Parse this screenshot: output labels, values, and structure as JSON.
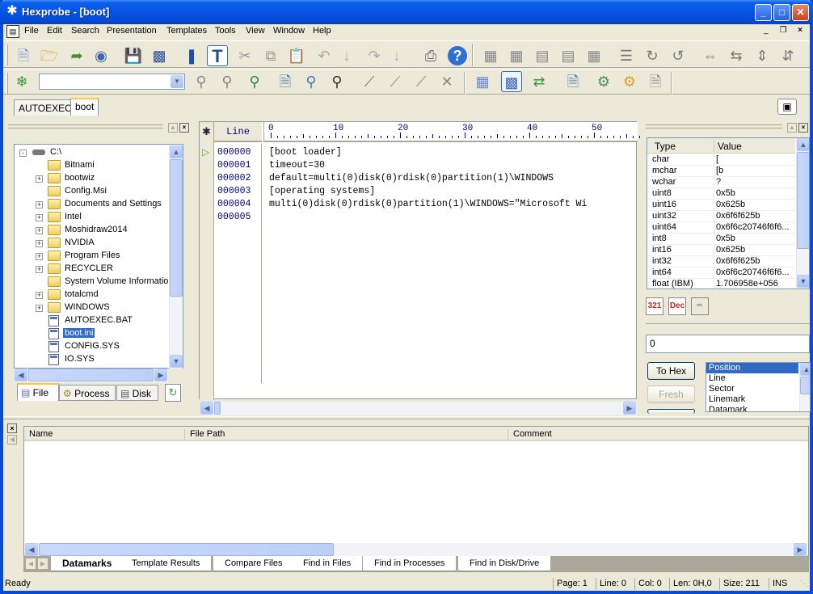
{
  "window": {
    "title": "Hexprobe - [boot]",
    "icon": "hexprobe-app-icon",
    "controls": [
      "minimize",
      "maximize",
      "close"
    ]
  },
  "menu": {
    "items": [
      "File",
      "Edit",
      "Search",
      "Presentation",
      "Templates",
      "Tools",
      "View",
      "Window",
      "Help"
    ],
    "mdi_controls": [
      "_",
      "❐",
      "×"
    ]
  },
  "toolbar1": {
    "icons": [
      "new-file-icon",
      "open-file-icon",
      "open-drive-icon",
      "open-disk-icon",
      "save-icon",
      "save-all-icon",
      "bookmark-icon",
      "text-mode-icon",
      "cut-icon",
      "copy-icon",
      "paste-icon",
      "undo-icon",
      "undo-down-icon",
      "redo-icon",
      "redo-down-icon",
      "print-icon",
      "help-icon",
      "grid-view-1-icon",
      "grid-view-2-icon",
      "grid-view-3-icon",
      "grid-view-4-icon",
      "grid-view-5-icon",
      "record-list-icon",
      "rotate-right-icon",
      "rotate-left-icon",
      "expand-horizontal-icon",
      "collapse-horizontal-icon",
      "expand-vertical-icon",
      "collapse-vertical-icon"
    ]
  },
  "toolbar2": {
    "search_combo_value": "",
    "icons": [
      "find-icon",
      "find-next-icon",
      "find-previous-icon",
      "find-in-files-icon",
      "find-in-processes-icon",
      "find-in-disk-icon",
      "mark-icon",
      "mark-next-icon",
      "mark-previous-icon",
      "clear-marks-icon",
      "calculator-icon",
      "data-inspector-icon",
      "base-converter-icon",
      "compare-files-icon",
      "template-settings-icon",
      "template-options-icon",
      "template-results-icon"
    ]
  },
  "doc_tabs": [
    {
      "label": "AUTOEXEC",
      "active": false
    },
    {
      "label": "boot",
      "active": true
    }
  ],
  "file_panel": {
    "tree": [
      {
        "label": "C:\\",
        "type": "drive",
        "level": 0,
        "expander": "-"
      },
      {
        "label": "Bitnami",
        "type": "folder",
        "level": 1,
        "expander": ""
      },
      {
        "label": "bootwiz",
        "type": "folder",
        "level": 1,
        "expander": "+"
      },
      {
        "label": "Config.Msi",
        "type": "folder",
        "level": 1,
        "expander": ""
      },
      {
        "label": "Documents and Settings",
        "type": "folder",
        "level": 1,
        "expander": "+"
      },
      {
        "label": "Intel",
        "type": "folder",
        "level": 1,
        "expander": "+"
      },
      {
        "label": "Moshidraw2014",
        "type": "folder",
        "level": 1,
        "expander": "+"
      },
      {
        "label": "NVIDIA",
        "type": "folder",
        "level": 1,
        "expander": "+"
      },
      {
        "label": "Program Files",
        "type": "folder",
        "level": 1,
        "expander": "+"
      },
      {
        "label": "RECYCLER",
        "type": "folder",
        "level": 1,
        "expander": "+"
      },
      {
        "label": "System Volume Information",
        "type": "folder",
        "level": 1,
        "expander": ""
      },
      {
        "label": "totalcmd",
        "type": "folder",
        "level": 1,
        "expander": "+"
      },
      {
        "label": "WINDOWS",
        "type": "folder",
        "level": 1,
        "expander": "+"
      },
      {
        "label": "AUTOEXEC.BAT",
        "type": "file",
        "level": 1,
        "expander": ""
      },
      {
        "label": "boot.ini",
        "type": "file",
        "level": 1,
        "expander": "",
        "selected": true
      },
      {
        "label": "CONFIG.SYS",
        "type": "file",
        "level": 1,
        "expander": ""
      },
      {
        "label": "IO.SYS",
        "type": "file",
        "level": 1,
        "expander": ""
      }
    ],
    "tabs": [
      {
        "label": "File",
        "active": true
      },
      {
        "label": "Process",
        "active": false
      },
      {
        "label": "Disk",
        "active": false
      }
    ]
  },
  "editor": {
    "line_header": "Line",
    "ruler_labels": [
      "0",
      "10",
      "20",
      "30",
      "40",
      "50"
    ],
    "lines": [
      {
        "num": "000000",
        "text": "[boot loader]"
      },
      {
        "num": "000001",
        "text": "timeout=30"
      },
      {
        "num": "000002",
        "text": "default=multi(0)disk(0)rdisk(0)partition(1)\\WINDOWS"
      },
      {
        "num": "000003",
        "text": "[operating systems]"
      },
      {
        "num": "000004",
        "text": "multi(0)disk(0)rdisk(0)partition(1)\\WINDOWS=\"Microsoft Wi"
      },
      {
        "num": "000005",
        "text": ""
      }
    ],
    "current_line_marker": "play-arrow"
  },
  "inspector": {
    "headers": [
      "Type",
      "Value"
    ],
    "rows": [
      {
        "type": "char",
        "value": "["
      },
      {
        "type": "mchar",
        "value": "[b"
      },
      {
        "type": "wchar",
        "value": "?"
      },
      {
        "type": "uint8",
        "value": "0x5b"
      },
      {
        "type": "uint16",
        "value": "0x625b"
      },
      {
        "type": "uint32",
        "value": "0x6f6f625b"
      },
      {
        "type": "uint64",
        "value": "0x6f6c20746f6f6..."
      },
      {
        "type": "int8",
        "value": "0x5b"
      },
      {
        "type": "int16",
        "value": "0x625b"
      },
      {
        "type": "int32",
        "value": "0x6f6f625b"
      },
      {
        "type": "int64",
        "value": "0x6f6c20746f6f6..."
      },
      {
        "type": "float (IBM)",
        "value": "1.706958e+056"
      }
    ],
    "buttons": [
      "byte-order-icon",
      "decimal-icon",
      "edit-value-icon"
    ],
    "byte_order_label": "321",
    "dec_label": "Dec",
    "value_input": "0",
    "to_hex_label": "To Hex",
    "fresh_label": "Fresh",
    "list_options": [
      "Position",
      "Line",
      "Sector",
      "Linemark",
      "Datamark"
    ],
    "list_selected": "Position"
  },
  "bottom_panel": {
    "columns": [
      "Name",
      "File Path",
      "Comment"
    ],
    "tabs": [
      {
        "label": "Datamarks",
        "active": true
      },
      {
        "label": "Template Results",
        "active": false
      },
      {
        "label": "Compare Files",
        "active": false
      },
      {
        "label": "Find in Files",
        "active": false
      },
      {
        "label": "Find in Processes",
        "active": false
      },
      {
        "label": "Find in Disk/Drive",
        "active": false
      }
    ]
  },
  "status": {
    "message": "Ready",
    "page": "Page: 1",
    "line": "Line: 0",
    "col": "Col: 0",
    "len": "Len: 0H,0",
    "size": "Size: 211",
    "mode": "INS"
  }
}
